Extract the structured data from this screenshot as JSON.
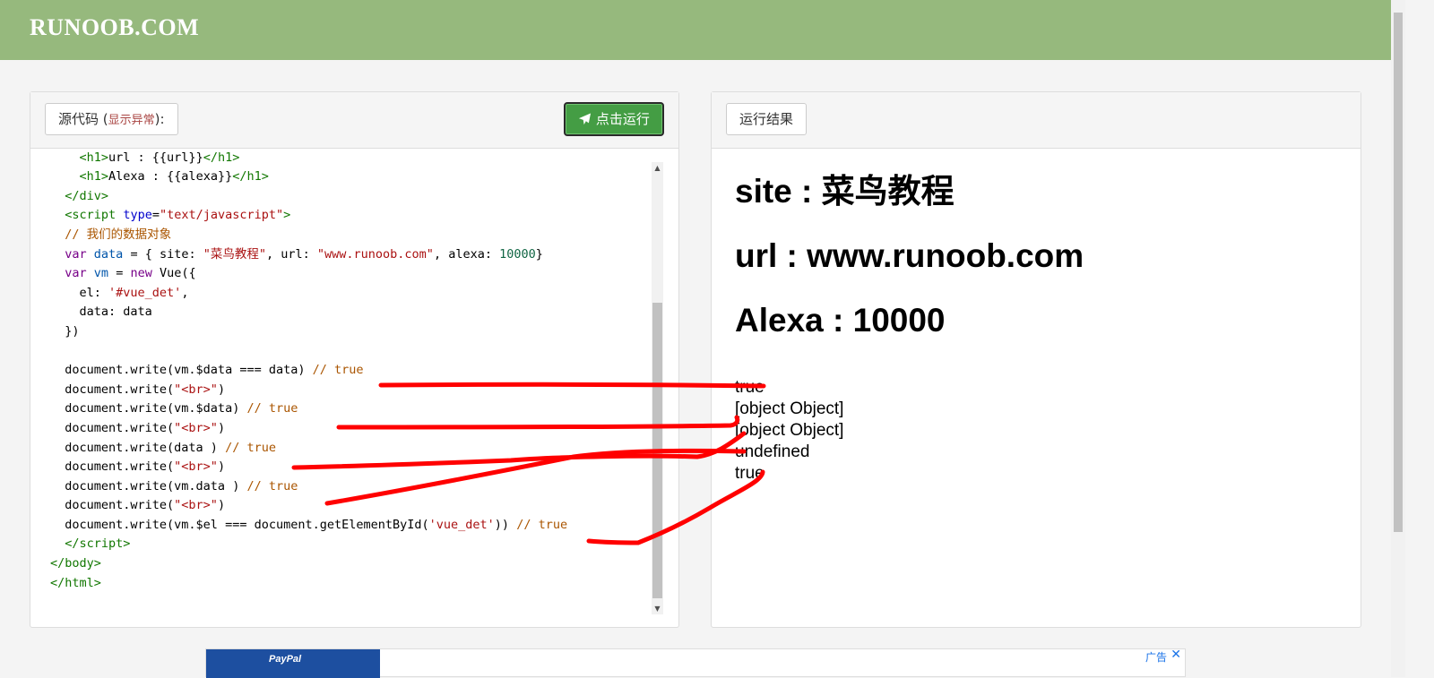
{
  "header": {
    "logo": "RUNOOB.COM"
  },
  "editor": {
    "source_label": "源代码",
    "warning_open": " (",
    "warning_label": "显示异常",
    "warning_close": "):",
    "run_label": "点击运行",
    "run_icon": "paper-plane-icon"
  },
  "result_panel": {
    "label": "运行结果",
    "headings": [
      "site : 菜鸟教程",
      "url : www.runoob.com",
      "Alexa : 10000"
    ],
    "lines": [
      "true",
      "[object Object]",
      "[object Object]",
      "undefined",
      "true"
    ]
  },
  "ad": {
    "brand": "PayPal",
    "label": "广告",
    "close": "✕"
  },
  "colors": {
    "header": "#96b97d",
    "run_button": "#449d44",
    "annotation": "#ff0000"
  }
}
